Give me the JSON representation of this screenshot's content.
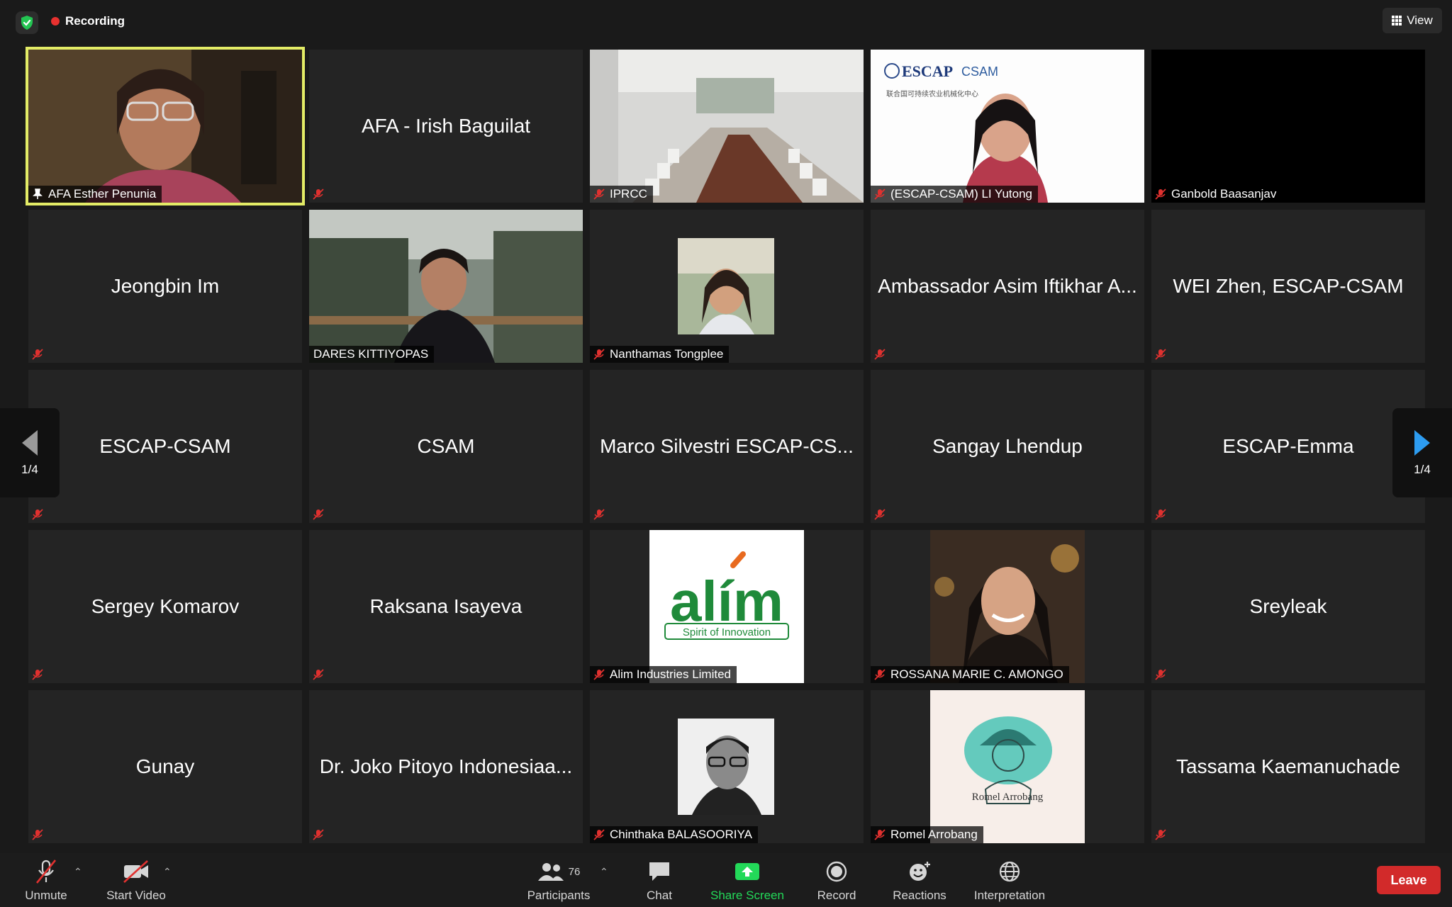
{
  "top": {
    "recording": "Recording",
    "view": "View"
  },
  "tiles": [
    {
      "name": "AFA Esther Penunia",
      "kind": "video",
      "active": true,
      "label": "AFA Esther Penunia"
    },
    {
      "name": "AFA - Irish Baguilat",
      "kind": "name"
    },
    {
      "name": "IPRCC",
      "kind": "video",
      "label": "IPRCC"
    },
    {
      "name": "(ESCAP-CSAM) LI Yutong",
      "kind": "video",
      "label": "(ESCAP-CSAM) LI Yutong",
      "logo_text": "ESCAP",
      "logo_sub": "CSAM",
      "logo_cn": "联合国可持续农业机械化中心"
    },
    {
      "name": "Ganbold Baasanjav",
      "kind": "black",
      "label": "Ganbold Baasanjav"
    },
    {
      "name": "Jeongbin Im",
      "kind": "name"
    },
    {
      "name": "DARES KITTIYOPAS",
      "kind": "video",
      "label": "DARES KITTIYOPAS"
    },
    {
      "name": "Nanthamas Tongplee",
      "kind": "avatar",
      "label": "Nanthamas Tongplee"
    },
    {
      "name": "Ambassador Asim Iftikhar A...",
      "kind": "name"
    },
    {
      "name": "WEI Zhen, ESCAP-CSAM",
      "kind": "name"
    },
    {
      "name": "ESCAP-CSAM",
      "kind": "name"
    },
    {
      "name": "CSAM",
      "kind": "name"
    },
    {
      "name": "Marco Silvestri ESCAP-CS...",
      "kind": "name"
    },
    {
      "name": "Sangay Lhendup",
      "kind": "name"
    },
    {
      "name": "ESCAP-Emma",
      "kind": "name"
    },
    {
      "name": "Sergey Komarov",
      "kind": "name"
    },
    {
      "name": "Raksana Isayeva",
      "kind": "name"
    },
    {
      "name": "Alim Industries Limited",
      "kind": "logo",
      "label": "Alim Industries Limited",
      "logo_text": "alím",
      "logo_sub": "Spirit of Innovation"
    },
    {
      "name": "ROSSANA MARIE C. AMONGO",
      "kind": "portrait",
      "label": "ROSSANA MARIE C. AMONGO"
    },
    {
      "name": "Sreyleak",
      "kind": "name"
    },
    {
      "name": "Gunay",
      "kind": "name"
    },
    {
      "name": "Dr. Joko Pitoyo Indonesiaa...",
      "kind": "name"
    },
    {
      "name": "Chinthaka BALASOORIYA",
      "kind": "avatar-bw",
      "label": "Chinthaka BALASOORIYA"
    },
    {
      "name": "Romel Arrobang",
      "kind": "illustration",
      "label": "Romel Arrobang",
      "logo_text": "Romel Arrobang"
    },
    {
      "name": "Tassama Kaemanuchade",
      "kind": "name"
    }
  ],
  "pager": {
    "left": "1/4",
    "right": "1/4"
  },
  "toolbar": {
    "unmute": "Unmute",
    "start_video": "Start Video",
    "participants": "Participants",
    "participants_count": "76",
    "chat": "Chat",
    "share_screen": "Share Screen",
    "record": "Record",
    "reactions": "Reactions",
    "interpretation": "Interpretation",
    "leave": "Leave"
  },
  "colors": {
    "active_border": "#e3ec66",
    "share_green": "#23d959",
    "leave_red": "#d22a2a",
    "mute_red": "#e0312f",
    "nav_blue": "#2d9cf0"
  }
}
